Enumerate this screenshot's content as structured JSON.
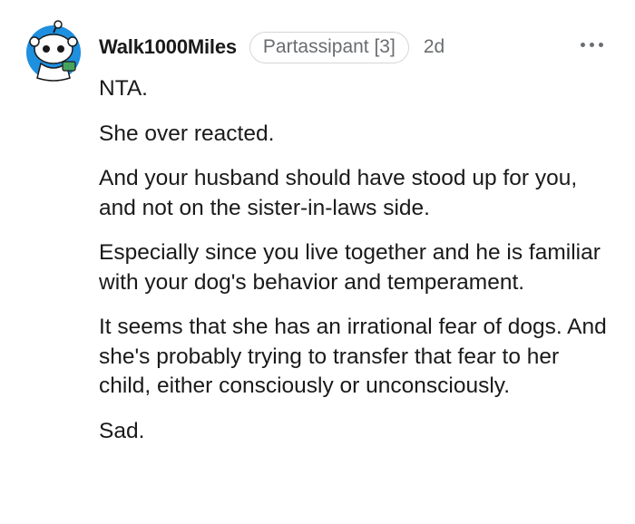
{
  "comment": {
    "username": "Walk1000Miles",
    "flair": "Partassipant [3]",
    "age": "2d",
    "more_icon": "ellipsis-horizontal",
    "paragraphs": [
      "NTA.",
      "She over reacted.",
      "And your husband should have stood up for you, and not on the sister-in-laws side.",
      "Especially since you live together and he is familiar with your dog's behavior and temperament.",
      "It seems that she has an irrational fear of dogs. And she's probably trying to transfer that fear to her child, either consciously or unconsciously.",
      "Sad."
    ]
  },
  "colors": {
    "avatar_background": "#1f8fe0",
    "meta_text": "#6a6d70",
    "body_text": "#1a1a1b"
  }
}
